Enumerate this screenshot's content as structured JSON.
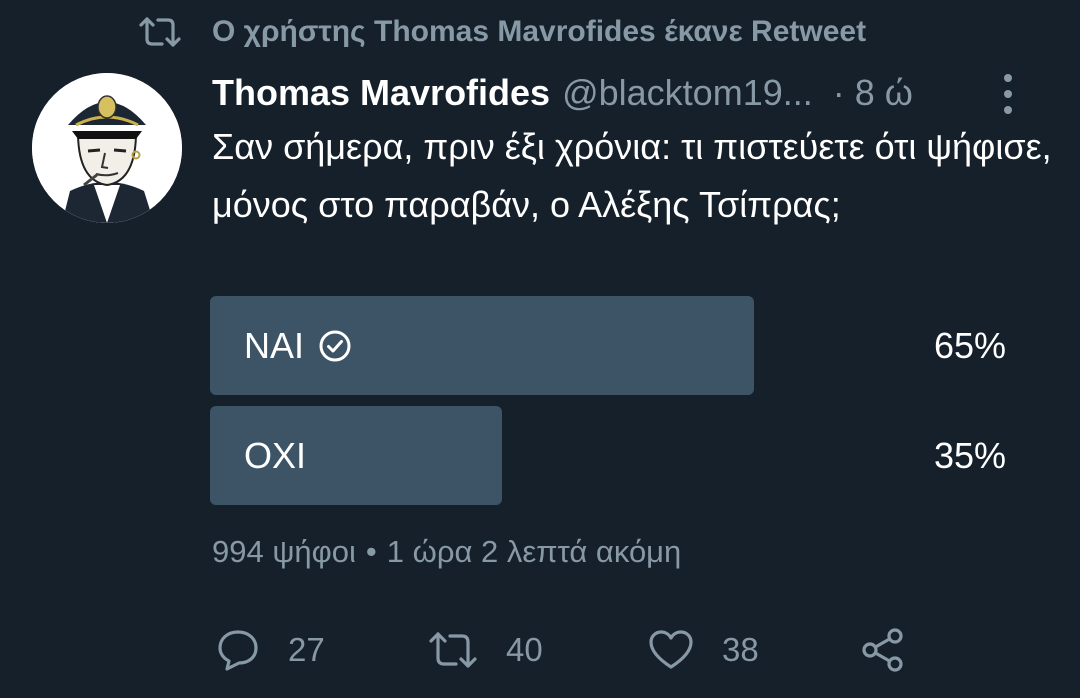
{
  "retweet_context": {
    "icon": "retweet-icon",
    "text": "Ο χρήστης Thomas Mavrofides έκανε Retweet"
  },
  "tweet": {
    "author_name": "Thomas Mavrofides",
    "author_handle": "@blacktom19...",
    "time": "· 8 ώ",
    "text": "Σαν σήμερα, πριν έξι χρόνια: τι πιστεύετε ότι ψήφισε, μόνος στο παραβάν, ο Αλέξης Τσίπρας;"
  },
  "poll": {
    "options": [
      {
        "label": "ΝΑΙ",
        "percent_text": "65%",
        "percent": 65,
        "selected": true,
        "icon": "check-circle-icon"
      },
      {
        "label": "ΟΧΙ",
        "percent_text": "35%",
        "percent": 35,
        "selected": false
      }
    ],
    "votes": "994 ψήφοι",
    "separator": "•",
    "time_left": "1 ώρα 2 λεπτά ακόμη"
  },
  "actions": {
    "reply": {
      "icon": "reply-icon",
      "count": "27"
    },
    "retweet": {
      "icon": "retweet-icon",
      "count": "40"
    },
    "like": {
      "icon": "heart-icon",
      "count": "38"
    },
    "share": {
      "icon": "share-icon"
    }
  },
  "colors": {
    "background": "#15202b",
    "poll_bar": "#3d5466",
    "secondary_text": "#8899a6",
    "primary_text": "#ffffff"
  }
}
